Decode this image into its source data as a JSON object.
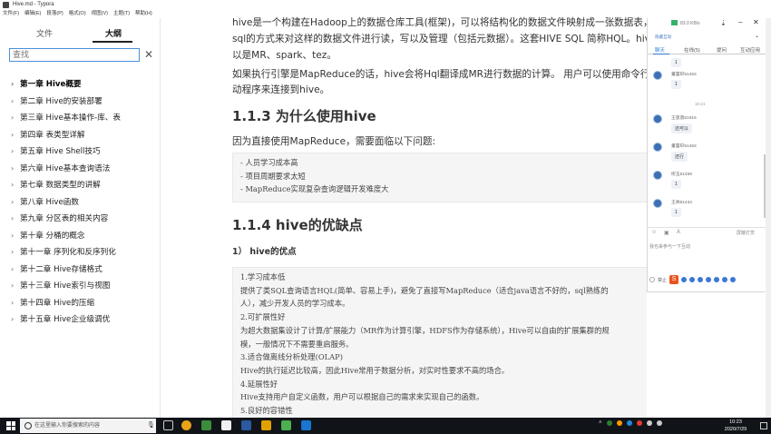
{
  "window": {
    "title": "Hive.md - Typora"
  },
  "menu": [
    "文件(F)",
    "编辑(E)",
    "段落(P)",
    "格式(O)",
    "视图(V)",
    "主题(T)",
    "帮助(H)"
  ],
  "sidebar": {
    "tabs": [
      "文件",
      "大纲"
    ],
    "search_placeholder": "查找",
    "outline": [
      "第一章 Hive概要",
      "第二章 Hive的安装部署",
      "第三章 Hive基本操作-库、表",
      "第四章 表类型详解",
      "第五章 Hive Shell技巧",
      "第六章 Hive基本查询语法",
      "第七章 数据类型的讲解",
      "第八章 Hive函数",
      "第九章 分区表的相关内容",
      "第十章 分桶的概念",
      "第十一章 序列化和反序列化",
      "第十二章 Hive存储格式",
      "第十三章 Hive索引与视图",
      "第十四章 Hive的压缩",
      "第十五章 Hive企业级调优"
    ]
  },
  "doc": {
    "para1_l1": "hive是一个构建在Hadoop上的数据仓库工具(框架)，可以将结构化的数据文件映射成一张数据表，并可",
    "para1_l2": "sql的方式来对这样的数据文件进行读，写以及管理（包括元数据）。这套HIVE SQL 简称HQL。hive的",
    "para1_l3": "以是MR、spark、tez。",
    "para2_l1": "如果执行引擎是MapReduce的话，hive会将Hql翻译成MR进行数据的计算。 用户可以使用命令行工具",
    "para2_l2": "动程序来连接到hive。",
    "h_113": "1.1.3 为什么使用hive",
    "para3": "因为直接使用MapReduce，需要面临以下问题:",
    "code1": [
      "- 人员学习成本高",
      "- 项目周期要求太短",
      "- MapReduce实现复杂查询逻辑开发难度大"
    ],
    "h_114": "1.1.4 hive的优缺点",
    "h_adv": "1） hive的优点",
    "code2": [
      "1.学习成本低",
      "    提供了类SQL查询语言HQL(简单、容易上手)，避免了直接写MapReduce（适合java语言不好的，sql熟练的",
      "    人），减少开发人员的学习成本。",
      "2.可扩展性好",
      "    为超大数据集设计了计算/扩展能力（MR作为计算引擎，HDFS作为存储系统），Hive可以自由的扩展集群的规",
      "    模，一般情况下不需要重启服务。",
      "3.适合做离线分析处理(OLAP)",
      "    Hive的执行延迟比较高，因此Hive常用于数据分析，对实时性要求不高的场合。",
      "4.延展性好",
      "    Hive支持用户自定义函数，用户可以根据自己的需求来实现自己的函数。",
      "5.良好的容错性"
    ]
  },
  "chat": {
    "top_status": "83.0 KB/s",
    "subtitle": "隐藏互动",
    "tabs": [
      "聊天",
      "在线(5)",
      "提问",
      "互动应用"
    ],
    "messages": [
      {
        "name": "",
        "text": "1"
      },
      {
        "name": "董蕾轩51463",
        "text": "1"
      },
      {
        "name": "王思蓉51915",
        "text": "还可以"
      },
      {
        "name": "董蕾轩51463",
        "text": "还行"
      },
      {
        "name": "缪玉51459",
        "text": "1"
      },
      {
        "name": "王帅51434",
        "text": "1"
      }
    ],
    "time_label": "10:21",
    "barrage_label": "屏蔽打赏",
    "input_placeholder": "我也来参与一下互动",
    "mute_label": "禁止",
    "colors": {
      "accent": "#2b7bd6",
      "online": "#34b36a"
    }
  },
  "taskbar": {
    "search_placeholder": "在这里输入你要搜索的内容",
    "time": "10:23",
    "date": "2020/7/29"
  }
}
